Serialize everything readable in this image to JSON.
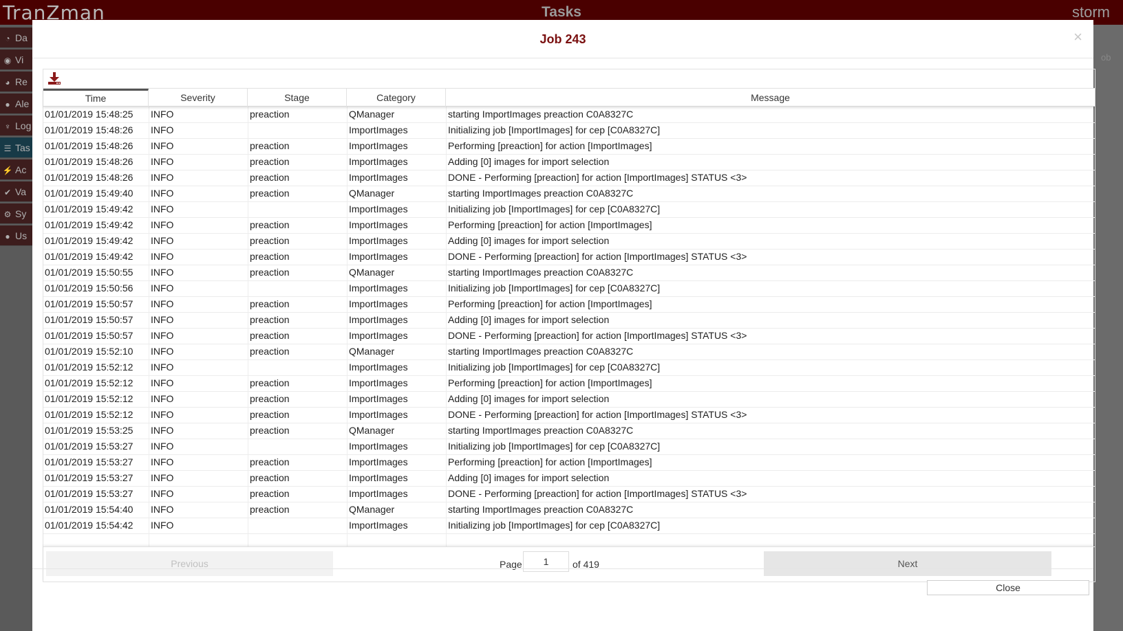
{
  "app": {
    "logo": "TranZman",
    "title": "Tasks",
    "brand": "storm"
  },
  "sidebar": {
    "items": [
      {
        "icon": "dashboard-icon",
        "label": "Da"
      },
      {
        "icon": "eye-icon",
        "label": "Vi"
      },
      {
        "icon": "pie-chart-icon",
        "label": "Re"
      },
      {
        "icon": "alert-icon",
        "label": "Ale"
      },
      {
        "icon": "stethoscope-icon",
        "label": "Log"
      },
      {
        "icon": "list-icon",
        "label": "Tas"
      },
      {
        "icon": "running-icon",
        "label": "Ac"
      },
      {
        "icon": "double-check-icon",
        "label": "Va"
      },
      {
        "icon": "gears-icon",
        "label": "Sy"
      },
      {
        "icon": "user-icon",
        "label": "Us"
      }
    ]
  },
  "background": {
    "ghost_text": "ob"
  },
  "modal": {
    "title": "Job 243",
    "close_symbol": "×",
    "download_icon": "download-icon",
    "columns": [
      "Time",
      "Severity",
      "Stage",
      "Category",
      "Message"
    ],
    "rows": [
      [
        "01/01/2019 15:48:25",
        "INFO",
        "preaction",
        "QManager",
        "starting ImportImages preaction C0A8327C"
      ],
      [
        "01/01/2019 15:48:26",
        "INFO",
        "",
        "ImportImages",
        "Initializing job [ImportImages] for cep [C0A8327C]"
      ],
      [
        "01/01/2019 15:48:26",
        "INFO",
        "preaction",
        "ImportImages",
        "Performing [preaction] for action [ImportImages]"
      ],
      [
        "01/01/2019 15:48:26",
        "INFO",
        "preaction",
        "ImportImages",
        "Adding [0] images for import selection"
      ],
      [
        "01/01/2019 15:48:26",
        "INFO",
        "preaction",
        "ImportImages",
        "DONE - Performing [preaction] for action [ImportImages] STATUS <3>"
      ],
      [
        "01/01/2019 15:49:40",
        "INFO",
        "preaction",
        "QManager",
        "starting ImportImages preaction C0A8327C"
      ],
      [
        "01/01/2019 15:49:42",
        "INFO",
        "",
        "ImportImages",
        "Initializing job [ImportImages] for cep [C0A8327C]"
      ],
      [
        "01/01/2019 15:49:42",
        "INFO",
        "preaction",
        "ImportImages",
        "Performing [preaction] for action [ImportImages]"
      ],
      [
        "01/01/2019 15:49:42",
        "INFO",
        "preaction",
        "ImportImages",
        "Adding [0] images for import selection"
      ],
      [
        "01/01/2019 15:49:42",
        "INFO",
        "preaction",
        "ImportImages",
        "DONE - Performing [preaction] for action [ImportImages] STATUS <3>"
      ],
      [
        "01/01/2019 15:50:55",
        "INFO",
        "preaction",
        "QManager",
        "starting ImportImages preaction C0A8327C"
      ],
      [
        "01/01/2019 15:50:56",
        "INFO",
        "",
        "ImportImages",
        "Initializing job [ImportImages] for cep [C0A8327C]"
      ],
      [
        "01/01/2019 15:50:57",
        "INFO",
        "preaction",
        "ImportImages",
        "Performing [preaction] for action [ImportImages]"
      ],
      [
        "01/01/2019 15:50:57",
        "INFO",
        "preaction",
        "ImportImages",
        "Adding [0] images for import selection"
      ],
      [
        "01/01/2019 15:50:57",
        "INFO",
        "preaction",
        "ImportImages",
        "DONE - Performing [preaction] for action [ImportImages] STATUS <3>"
      ],
      [
        "01/01/2019 15:52:10",
        "INFO",
        "preaction",
        "QManager",
        "starting ImportImages preaction C0A8327C"
      ],
      [
        "01/01/2019 15:52:12",
        "INFO",
        "",
        "ImportImages",
        "Initializing job [ImportImages] for cep [C0A8327C]"
      ],
      [
        "01/01/2019 15:52:12",
        "INFO",
        "preaction",
        "ImportImages",
        "Performing [preaction] for action [ImportImages]"
      ],
      [
        "01/01/2019 15:52:12",
        "INFO",
        "preaction",
        "ImportImages",
        "Adding [0] images for import selection"
      ],
      [
        "01/01/2019 15:52:12",
        "INFO",
        "preaction",
        "ImportImages",
        "DONE - Performing [preaction] for action [ImportImages] STATUS <3>"
      ],
      [
        "01/01/2019 15:53:25",
        "INFO",
        "preaction",
        "QManager",
        "starting ImportImages preaction C0A8327C"
      ],
      [
        "01/01/2019 15:53:27",
        "INFO",
        "",
        "ImportImages",
        "Initializing job [ImportImages] for cep [C0A8327C]"
      ],
      [
        "01/01/2019 15:53:27",
        "INFO",
        "preaction",
        "ImportImages",
        "Performing [preaction] for action [ImportImages]"
      ],
      [
        "01/01/2019 15:53:27",
        "INFO",
        "preaction",
        "ImportImages",
        "Adding [0] images for import selection"
      ],
      [
        "01/01/2019 15:53:27",
        "INFO",
        "preaction",
        "ImportImages",
        "DONE - Performing [preaction] for action [ImportImages] STATUS <3>"
      ],
      [
        "01/01/2019 15:54:40",
        "INFO",
        "preaction",
        "QManager",
        "starting ImportImages preaction C0A8327C"
      ],
      [
        "01/01/2019 15:54:42",
        "INFO",
        "",
        "ImportImages",
        "Initializing job [ImportImages] for cep [C0A8327C]"
      ]
    ],
    "pagination": {
      "previous_label": "Previous",
      "next_label": "Next",
      "page_label": "Page",
      "page_value": "1",
      "of_label": "of 419"
    },
    "close_label": "Close"
  },
  "colors": {
    "brand_dark": "#4a0000",
    "title_red": "#7a1010",
    "active_nav": "#173a47"
  }
}
